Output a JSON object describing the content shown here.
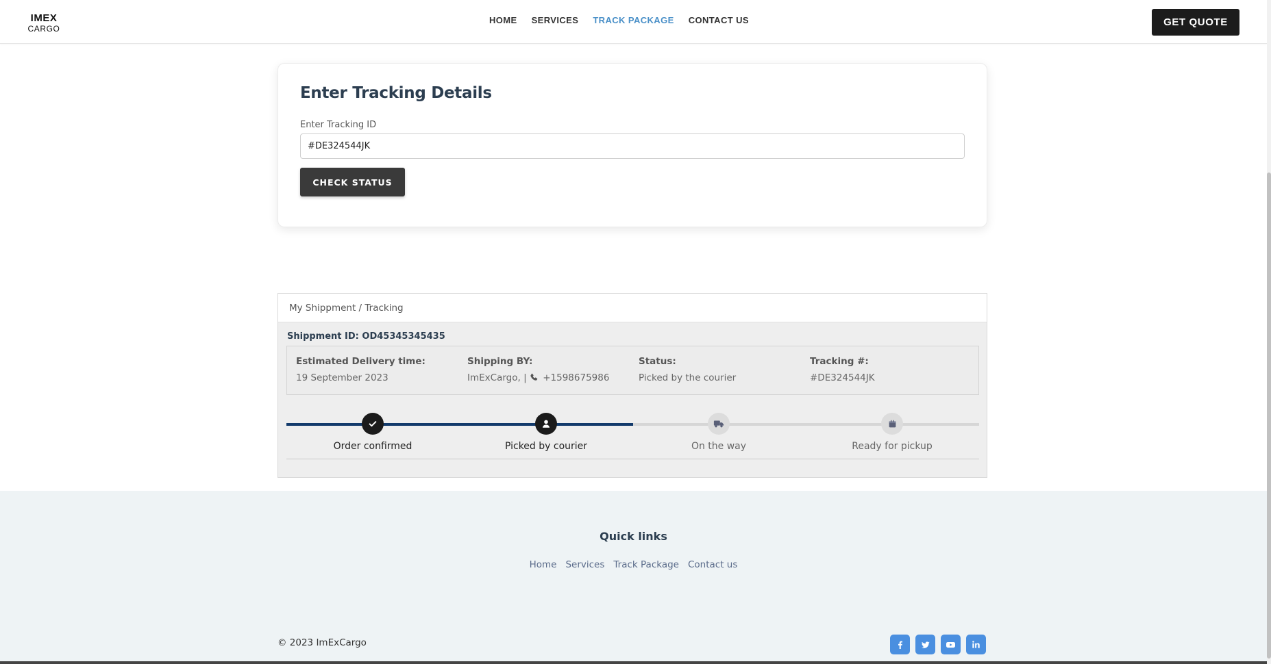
{
  "nav": {
    "logo_main": "IMEX",
    "logo_sub": "CARGO",
    "links": [
      {
        "label": "HOME",
        "active": false
      },
      {
        "label": "SERVICES",
        "active": false
      },
      {
        "label": "TRACK PACKAGE",
        "active": true
      },
      {
        "label": "CONTACT US",
        "active": false
      }
    ],
    "quote_label": "GET QUOTE"
  },
  "tracking_form": {
    "title": "Enter Tracking Details",
    "field_label": "Enter Tracking ID",
    "field_value": "#DE324544JK",
    "button_label": "CHECK STATUS"
  },
  "shipment": {
    "breadcrumb": "My Shippment / Tracking",
    "id_label": "Shippment ID:",
    "id_value": "OD45345345435",
    "info": {
      "delivery_title": "Estimated Delivery time:",
      "delivery_value": "19 September 2023",
      "shipping_title": "Shipping BY:",
      "shipping_value": "ImExCargo, |",
      "shipping_phone": "+1598675986",
      "status_title": "Status:",
      "status_value": "Picked by the courier",
      "tracking_title": "Tracking #:",
      "tracking_value": "#DE324544JK"
    },
    "progress_fraction": 0.5,
    "steps": [
      {
        "label": "Order confirmed",
        "icon": "check-icon",
        "done": true
      },
      {
        "label": "Picked by courier",
        "icon": "user-icon",
        "done": true
      },
      {
        "label": "On the way",
        "icon": "truck-icon",
        "done": false
      },
      {
        "label": "Ready for pickup",
        "icon": "box-icon",
        "done": false
      }
    ]
  },
  "footer": {
    "quick_links_title": "Quick links",
    "quick_links": [
      "Home",
      "Services",
      "Track Package",
      "Contact us"
    ],
    "copyright": "© 2023 ImExCargo",
    "socials": [
      {
        "icon": "facebook-icon",
        "glyph": "f"
      },
      {
        "icon": "twitter-icon",
        "glyph": "t"
      },
      {
        "icon": "youtube-icon",
        "glyph": "▶"
      },
      {
        "icon": "linkedin-icon",
        "glyph": "in"
      }
    ]
  },
  "colors": {
    "accent": "#4a90c8",
    "progress_fill": "#123a6b",
    "dark_button": "#1c1c1c",
    "social_blue": "#4a8fe0",
    "footer_bg": "#eef3f5"
  }
}
